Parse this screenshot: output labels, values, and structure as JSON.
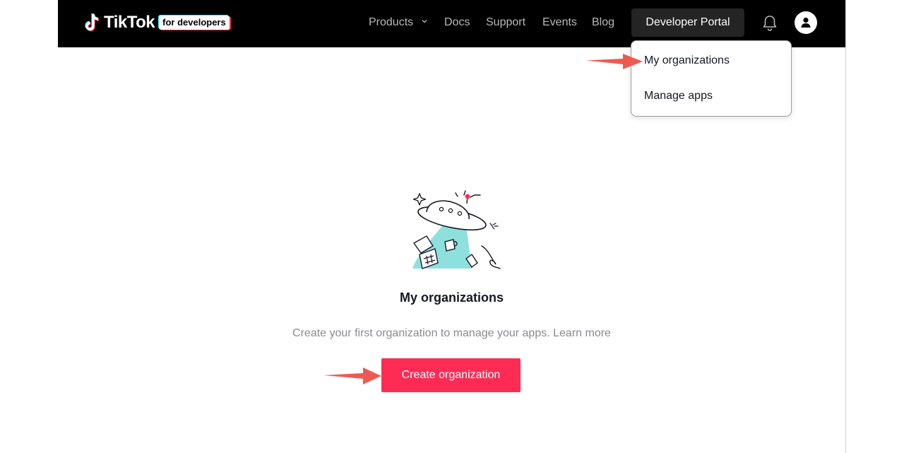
{
  "brand": {
    "name": "TikTok",
    "badge": "for developers",
    "colors": {
      "accent": "#fe2c55",
      "cyan": "#25f4ee",
      "nav_bg": "#000000"
    }
  },
  "nav": {
    "products": "Products",
    "docs": "Docs",
    "support": "Support",
    "events": "Events",
    "blog": "Blog",
    "portal": "Developer Portal",
    "icons": [
      "chevron-down-icon",
      "bell-icon",
      "user-avatar-icon"
    ]
  },
  "dropdown": {
    "items": [
      "My organizations",
      "Manage apps"
    ]
  },
  "main": {
    "title": "My organizations",
    "subtitle": "Create your first organization to manage your apps.",
    "learn_more": "Learn more",
    "create_button": "Create organization",
    "illustration": "ufo-illustration"
  },
  "annotations": {
    "arrow_color": "#ee5a52"
  }
}
